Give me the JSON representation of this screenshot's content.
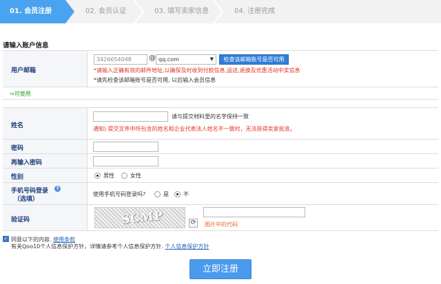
{
  "steps": [
    {
      "label": "01. 会员注册",
      "active": true
    },
    {
      "label": "02. 会员认证",
      "active": false
    },
    {
      "label": "03. 填写卖家信息",
      "active": false
    },
    {
      "label": "04. 注册完成",
      "active": false
    }
  ],
  "section_title": "请输入账户信息",
  "email": {
    "label": "用户邮箱",
    "user_value": "3426654048",
    "at": "@",
    "domain_selected": "qq.com",
    "check_button": "检查该邮箱账号是否可用",
    "hint_red": "*请输入正确有效的邮件地址,以确保及时收到付款信息,运送,退换及优惠活动中奖信息",
    "hint_dark": "*请先检查该邮箱账号是否可用, 以后输入会员信息"
  },
  "email_available": "↪可使用",
  "name": {
    "label": "姓名",
    "hint": "请与提交材料里的名字保持一致",
    "notice": "通知) 提交文件中所包含的姓名和企业代表法人姓名不一致时，无法获得卖家批准。"
  },
  "password": {
    "label": "密码"
  },
  "password_confirm": {
    "label": "再输入密码"
  },
  "gender": {
    "label": "性别",
    "options": [
      "男性",
      "女性"
    ],
    "selected": "男性"
  },
  "phone_login": {
    "label_line1": "手机号码登录",
    "label_line2": "（选填）",
    "question": "使用手机号码登录吗?",
    "options": [
      "是",
      "不"
    ],
    "selected": "不"
  },
  "captcha": {
    "label": "验证码",
    "image_text": "SCMP",
    "hint": "图片中的代码"
  },
  "agree": {
    "prefix": "同意以下的内容.",
    "terms_link": "使用条款",
    "line2_prefix": "有关Qoo10个人信息保护方针，详情请参考个人信息保护方针.",
    "privacy_link": "个人信息保护方针"
  },
  "submit_label": "立即注册",
  "colors": {
    "step_active": "#4aa3ee",
    "step_inactive": "#f2f2f2",
    "label_text": "#1d3f7a",
    "warning_red": "#e2321f",
    "hint_orange": "#e8661a",
    "submit_blue": "#4a9aee"
  }
}
